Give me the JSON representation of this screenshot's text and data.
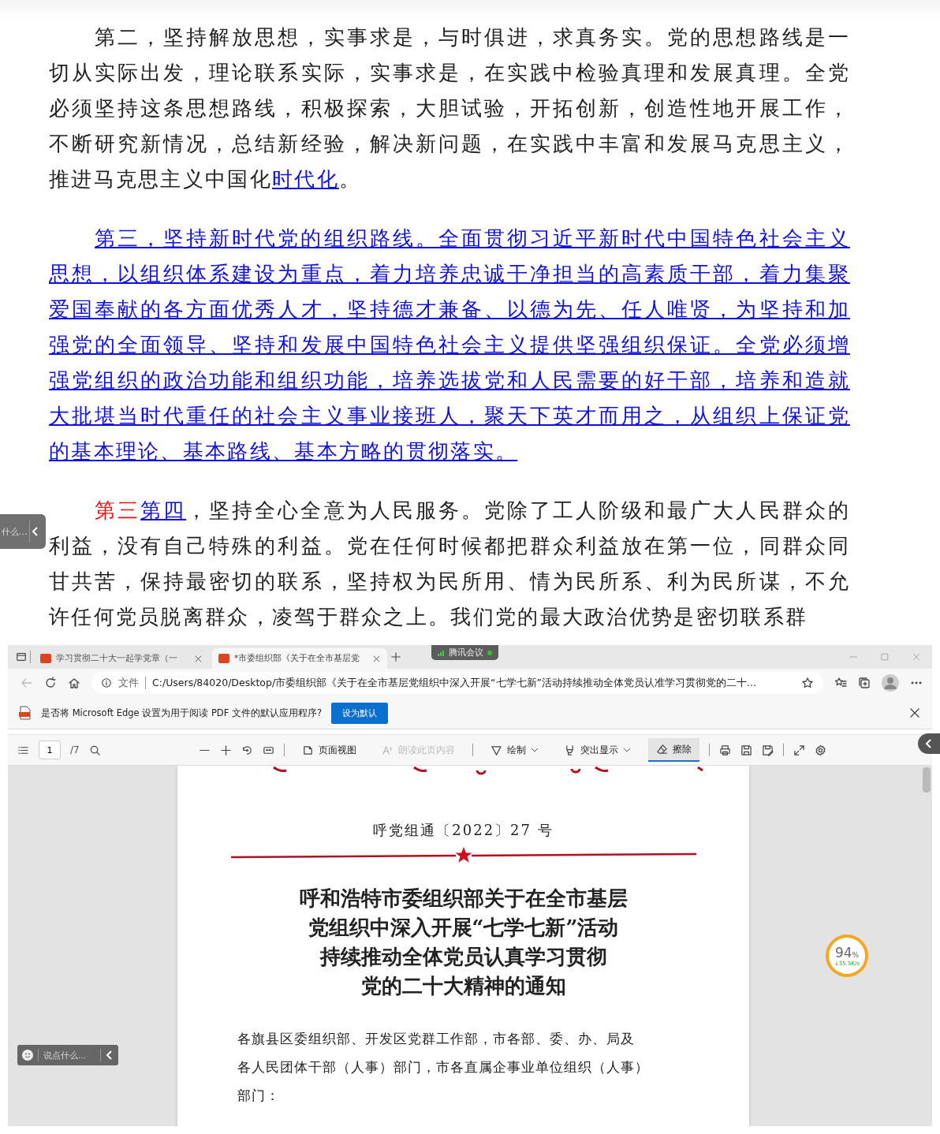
{
  "document": {
    "paragraphs": [
      {
        "segments": [
          {
            "kind": "normal",
            "text": "第二，坚持解放思想，实事求是，与时俱进，求真务实。党的思想路线是一切从实际出发，理论联系实际，实事求是，在实践中检验真理和发展真理。全党必须坚持这条思想路线，积极探索，大胆试验，开拓创新，创造性地开展工作，不断研究新情况，总结新经验，解决新问题，在实践中丰富和发展马克思主义，推进马克思主义中国化"
          },
          {
            "kind": "inserted",
            "text": "时代化"
          },
          {
            "kind": "normal",
            "text": "。"
          }
        ]
      },
      {
        "segments": [
          {
            "kind": "inserted",
            "text": "第三，坚持新时代党的组织路线。全面贯彻习近平新时代中国特色社会主义思想，以组织体系建设为重点，着力培养忠诚干净担当的高素质干部，着力集聚爱国奉献的各方面优秀人才，坚持德才兼备、以德为先、任人唯贤，为坚持和加强党的全面领导、坚持和发展中国特色社会主义提供坚强组织保证。全党必须增强党组织的政治功能和组织功能，培养选拔党和人民需要的好干部，培养和造就大批堪当时代重任的社会主义事业接班人，聚天下英才而用之，从组织上保证党的基本理论、基本路线、基本方略的贯彻落实。"
          }
        ]
      },
      {
        "segments": [
          {
            "kind": "deleted",
            "text": "第三"
          },
          {
            "kind": "inserted",
            "text": "第四"
          },
          {
            "kind": "normal",
            "text": "，坚持全心全意为人民服务。党除了工人阶级和最广大人民群众的利益，没有自己特殊的利益。党在任何时候都把群众利益放在第一位，同群众同甘共苦，保持最密切的联系，坚持权为民所用、情为民所系、利为民所谋，不允许任何党员脱离群众，凌驾于群众之上。我们党的最大政治优势是密切联系群"
          }
        ]
      }
    ]
  },
  "top_comment_widget": {
    "text": "什么..."
  },
  "browser": {
    "tabs": [
      {
        "title": "学习贯彻二十大一起学党章（一",
        "selected": false
      },
      {
        "title": "*市委组织部《关于在全市基层党",
        "selected": true
      }
    ],
    "meeting_badge": "腾讯会议",
    "address": {
      "scheme": "文件",
      "url": "C:/Users/84020/Desktop/市委组织部《关于在全市基层党组织中深入开展“七学七新”活动持续推动全体党员认准学习贯彻党的二十..."
    },
    "infobar": {
      "message": "是否将 Microsoft Edge 设置为用于阅读 PDF 文件的默认应用程序?",
      "button": "设为默认"
    },
    "pdf_toolbar": {
      "page": "1",
      "page_count": "/7",
      "tools": [
        {
          "label": "页面视图",
          "disabled": false,
          "selected": false,
          "dropdown": false
        },
        {
          "label": "朗读此页内容",
          "disabled": true,
          "selected": false,
          "dropdown": false
        },
        {
          "label": "绘制",
          "disabled": false,
          "selected": false,
          "dropdown": true
        },
        {
          "label": "突出显示",
          "disabled": false,
          "selected": false,
          "dropdown": true
        },
        {
          "label": "擦除",
          "disabled": false,
          "selected": true,
          "dropdown": false
        }
      ]
    },
    "pdf_page": {
      "doc_number": "呼党组通〔2022〕27 号",
      "title_lines": [
        "呼和浩特市委组织部关于在全市基层",
        "党组织中深入开展“七学七新”活动",
        "持续推动全体党员认真学习贯彻",
        "党的二十大精神的通知"
      ],
      "addressee_lines": [
        "各旗县区委组织部、开发区党群工作部，市各部、委、办、局及",
        "各人民团体干部（人事）部门，市各直属企事业单位组织（人事）",
        "部门："
      ]
    },
    "chat_widget": {
      "placeholder": "说点什么..."
    },
    "speed_meter": {
      "percent": "94",
      "unit": "%",
      "speed": "↓35.5K/s"
    }
  }
}
